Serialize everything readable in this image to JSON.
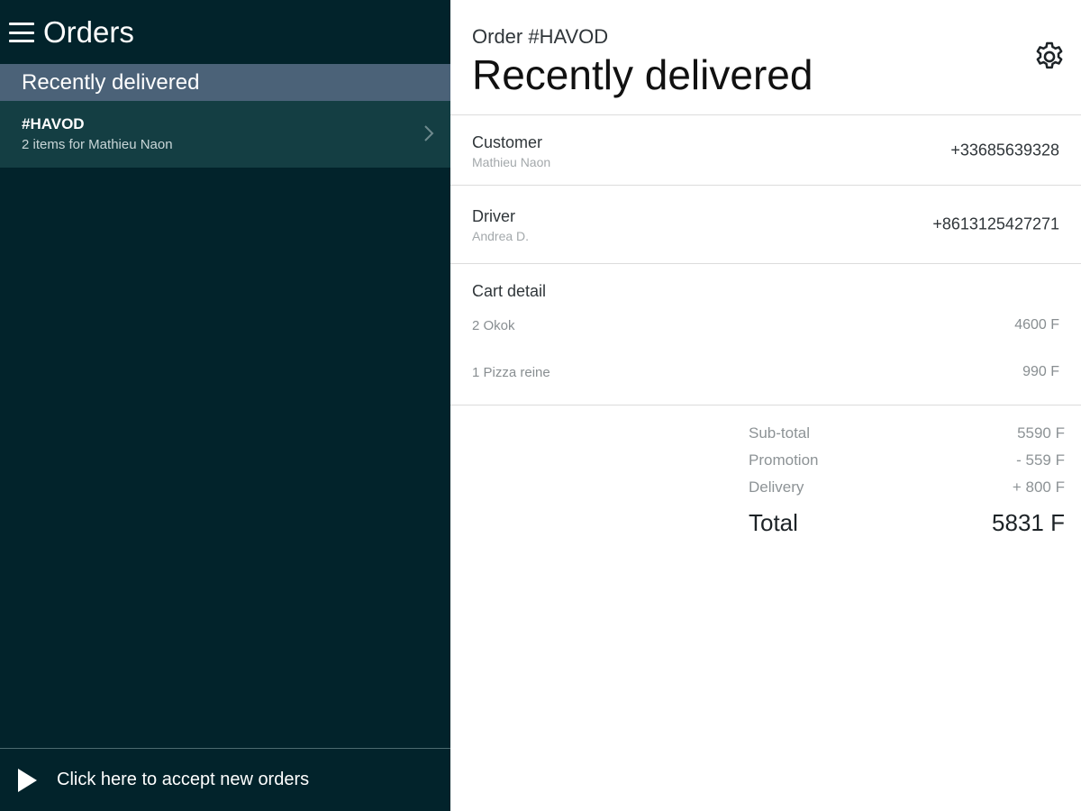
{
  "sidebar": {
    "title": "Orders",
    "section_label": "Recently delivered",
    "orders": [
      {
        "id": "#HAVOD",
        "summary": "2 items for Mathieu Naon"
      }
    ],
    "footer_label": "Click here to accept new orders"
  },
  "detail": {
    "order_label": "Order #HAVOD",
    "title": "Recently delivered",
    "customer": {
      "label": "Customer",
      "name": "Mathieu Naon",
      "phone": "+33685639328"
    },
    "driver": {
      "label": "Driver",
      "name": "Andrea D.",
      "phone": "+8613125427271"
    },
    "cart": {
      "title": "Cart detail",
      "items": [
        {
          "name": "2 Okok",
          "price": "4600 F"
        },
        {
          "name": "1 Pizza reine",
          "price": "990 F"
        }
      ]
    },
    "totals": {
      "subtotal_label": "Sub-total",
      "subtotal": "5590 F",
      "promotion_label": "Promotion",
      "promotion": "- 559 F",
      "delivery_label": "Delivery",
      "delivery": "+ 800 F",
      "total_label": "Total",
      "total": "5831 F"
    }
  },
  "icons": {
    "menu": "hamburger-menu-icon",
    "chevron": "chevron-right-icon",
    "play": "play-icon",
    "settings": "gear-icon"
  },
  "colors": {
    "sidebar_bg": "#02232b",
    "section_header_bg": "#4b6278",
    "selected_row_bg": "#143e43"
  }
}
